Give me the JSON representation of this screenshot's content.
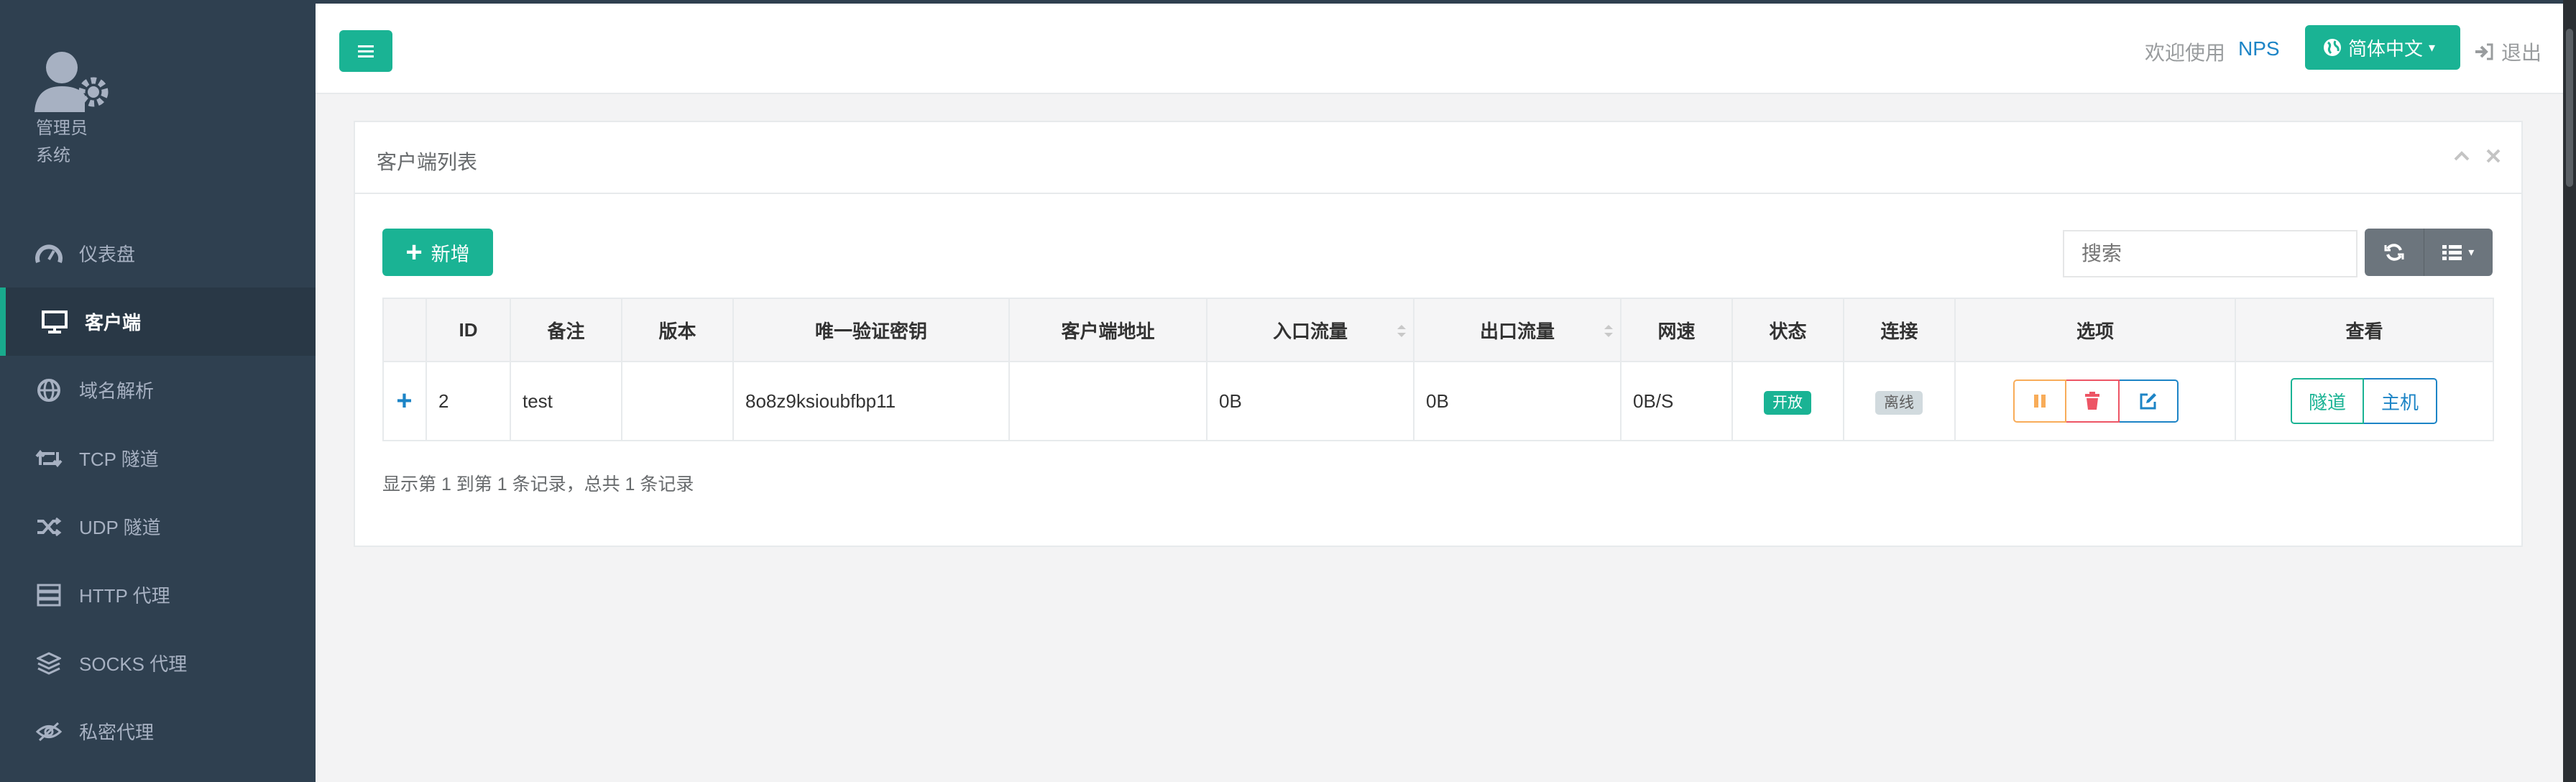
{
  "sidebar": {
    "role": "管理员",
    "system": "系统",
    "items": [
      {
        "label": "仪表盘",
        "icon": "dashboard-icon",
        "active": false
      },
      {
        "label": "客户端",
        "icon": "desktop-icon",
        "active": true
      },
      {
        "label": "域名解析",
        "icon": "globe-icon",
        "active": false
      },
      {
        "label": "TCP 隧道",
        "icon": "retweet-icon",
        "active": false
      },
      {
        "label": "UDP 隧道",
        "icon": "random-icon",
        "active": false
      },
      {
        "label": "HTTP 代理",
        "icon": "server-icon",
        "active": false
      },
      {
        "label": "SOCKS 代理",
        "icon": "layers-icon",
        "active": false
      },
      {
        "label": "私密代理",
        "icon": "eye-slash-icon",
        "active": false
      }
    ]
  },
  "header": {
    "welcome": "欢迎使用",
    "brand": "NPS",
    "language": "简体中文",
    "logout": "退出"
  },
  "panel": {
    "title": "客户端列表",
    "add_label": "新增",
    "search_placeholder": "搜索"
  },
  "table": {
    "columns": [
      "ID",
      "备注",
      "版本",
      "唯一验证密钥",
      "客户端地址",
      "入口流量",
      "出口流量",
      "网速",
      "状态",
      "连接",
      "选项",
      "查看"
    ],
    "rows": [
      {
        "expand": "+",
        "id": "2",
        "remark": "test",
        "version": "",
        "vkey": "8o8z9ksioubfbp11",
        "addr": "",
        "in_flow": "0B",
        "out_flow": "0B",
        "speed": "0B/S",
        "status": "开放",
        "connect": "离线",
        "view_tunnel": "隧道",
        "view_host": "主机"
      }
    ],
    "pagination": "显示第 1 到第 1 条记录，总共 1 条记录"
  },
  "colors": {
    "primary": "#1ab394",
    "sidebar": "#2f4050",
    "link": "#1c84c6",
    "danger": "#ed5565",
    "warning": "#f8ac59"
  }
}
